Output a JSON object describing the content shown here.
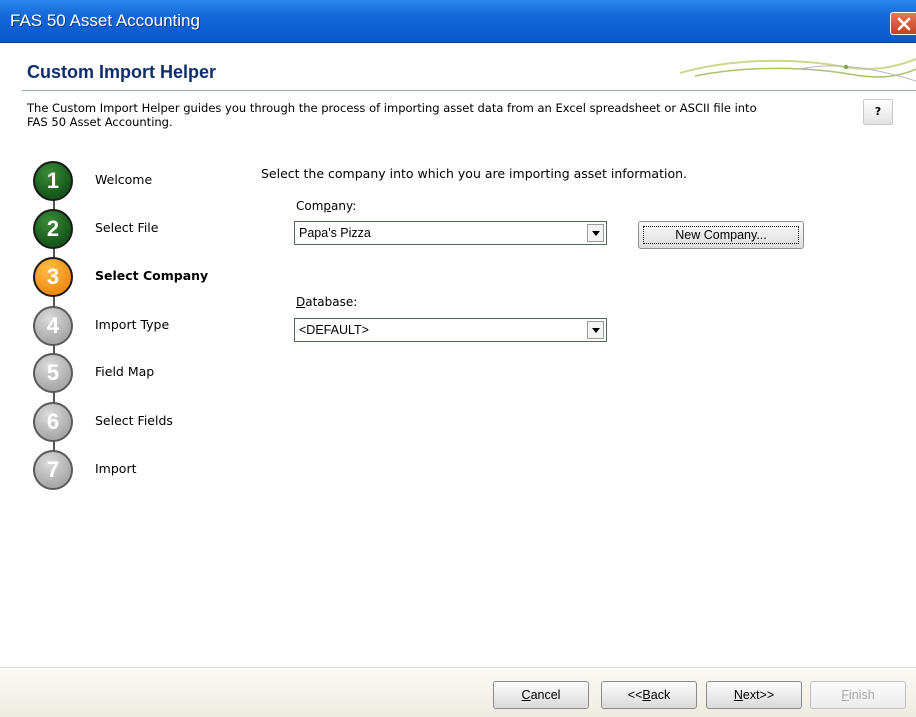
{
  "window": {
    "title": "FAS 50 Asset Accounting"
  },
  "header": {
    "title": "Custom Import Helper",
    "intro_line1": "The Custom Import Helper guides you through the process of importing asset data from an Excel spreadsheet or ASCII file into",
    "intro_line2": "FAS 50 Asset Accounting.",
    "help_label": "?"
  },
  "steps": [
    {
      "number": "1",
      "label": "Welcome",
      "state": "done"
    },
    {
      "number": "2",
      "label": "Select File",
      "state": "done"
    },
    {
      "number": "3",
      "label": "Select Company",
      "state": "active"
    },
    {
      "number": "4",
      "label": "Import Type",
      "state": "pending"
    },
    {
      "number": "5",
      "label": "Field Map",
      "state": "pending"
    },
    {
      "number": "6",
      "label": "Select Fields",
      "state": "pending"
    },
    {
      "number": "7",
      "label": "Import",
      "state": "pending"
    }
  ],
  "main": {
    "prompt": "Select the company into which you are importing asset information.",
    "company_label_pre": "Com",
    "company_label_u": "p",
    "company_label_post": "any:",
    "company_value": "Papa's Pizza",
    "new_company_label": "New Company...",
    "database_label_u": "D",
    "database_label_post": "atabase:",
    "database_value": "<DEFAULT>"
  },
  "footer": {
    "cancel_u": "C",
    "cancel_rest": "ancel",
    "back_pre": "<<",
    "back_u": "B",
    "back_rest": "ack",
    "next_u": "N",
    "next_rest": "ext>>",
    "finish_u": "F",
    "finish_rest": "inish"
  },
  "colors": {
    "titlebar": "#1467d8",
    "step_done": "#15571a",
    "step_active": "#ef8c14",
    "step_pending": "#a9a9a9",
    "header_title": "#0e2d6a"
  }
}
